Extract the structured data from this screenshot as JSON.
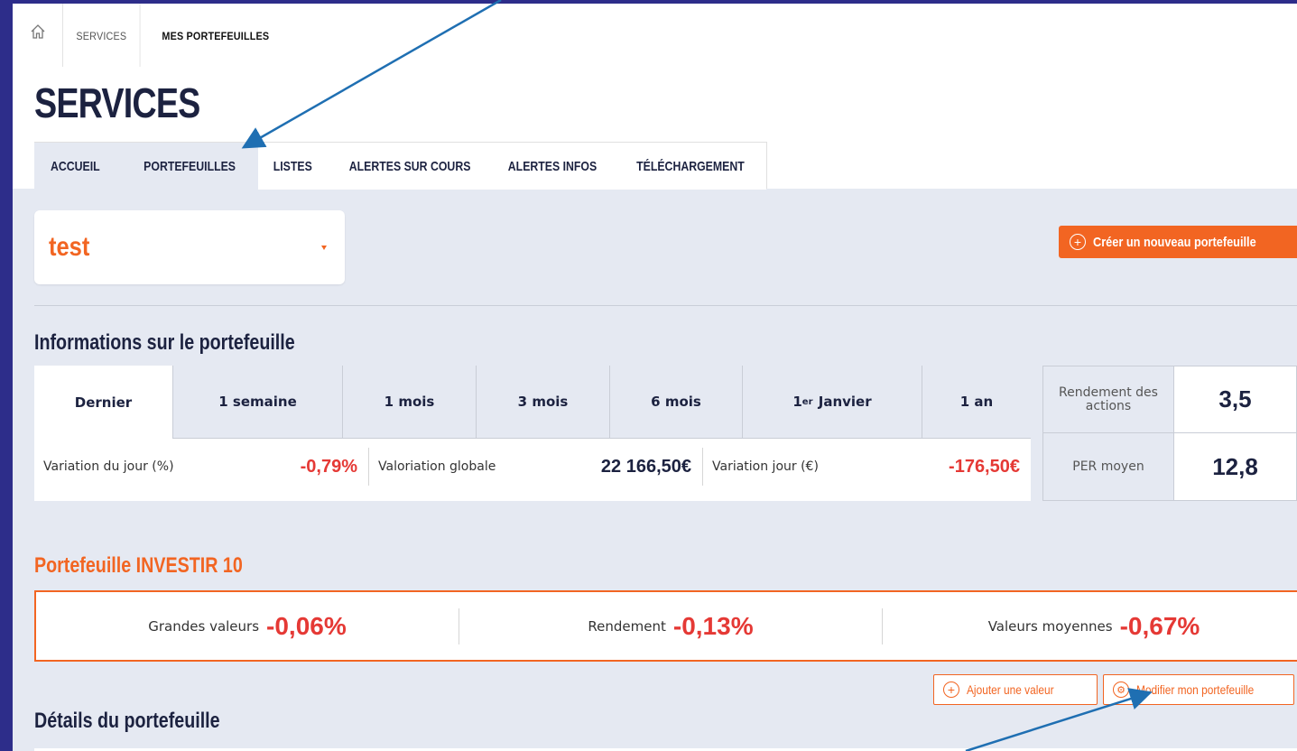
{
  "breadcrumb": {
    "items": [
      "SERVICES",
      "MES PORTEFEUILLES"
    ]
  },
  "page": {
    "title": "SERVICES"
  },
  "tabs": [
    "ACCUEIL",
    "PORTEFEUILLES",
    "LISTES",
    "ALERTES SUR COURS",
    "ALERTES INFOS",
    "TÉLÉCHARGEMENT"
  ],
  "portfolio_select": {
    "value": "test"
  },
  "create_button": {
    "label": "Créer un nouveau portefeuille"
  },
  "info": {
    "title": "Informations sur le portefeuille",
    "periods": [
      "Dernier",
      "1 semaine",
      "1 mois",
      "3 mois",
      "6 mois",
      "Janvier",
      "1 an"
    ],
    "period_first_prefix": "1",
    "period_first_sup": "er",
    "stats": [
      {
        "label": "Variation du jour (%)",
        "value": "-0,79%"
      },
      {
        "label": "Valoriation globale",
        "value": "22 166,50€"
      },
      {
        "label": "Variation jour (€)",
        "value": "-176,50€"
      }
    ],
    "side": [
      {
        "label": "Rendement des actions",
        "value": "3,5"
      },
      {
        "label": "PER moyen",
        "value": "12,8"
      }
    ]
  },
  "investir": {
    "title": "Portefeuille INVESTIR 10",
    "items": [
      {
        "label": "Grandes valeurs",
        "value": "-0,06%"
      },
      {
        "label": "Rendement",
        "value": "-0,13%"
      },
      {
        "label": "Valeurs moyennes",
        "value": "-0,67%"
      }
    ]
  },
  "actions": {
    "add_value": "Ajouter une valeur",
    "edit_portfolio": "Modifier mon portefeuille"
  },
  "details": {
    "title": "Détails du portefeuille"
  },
  "colors": {
    "accent": "#f26522",
    "negative": "#e53935",
    "navy": "#1c2240",
    "annotation_arrow": "#1f6fb2"
  }
}
